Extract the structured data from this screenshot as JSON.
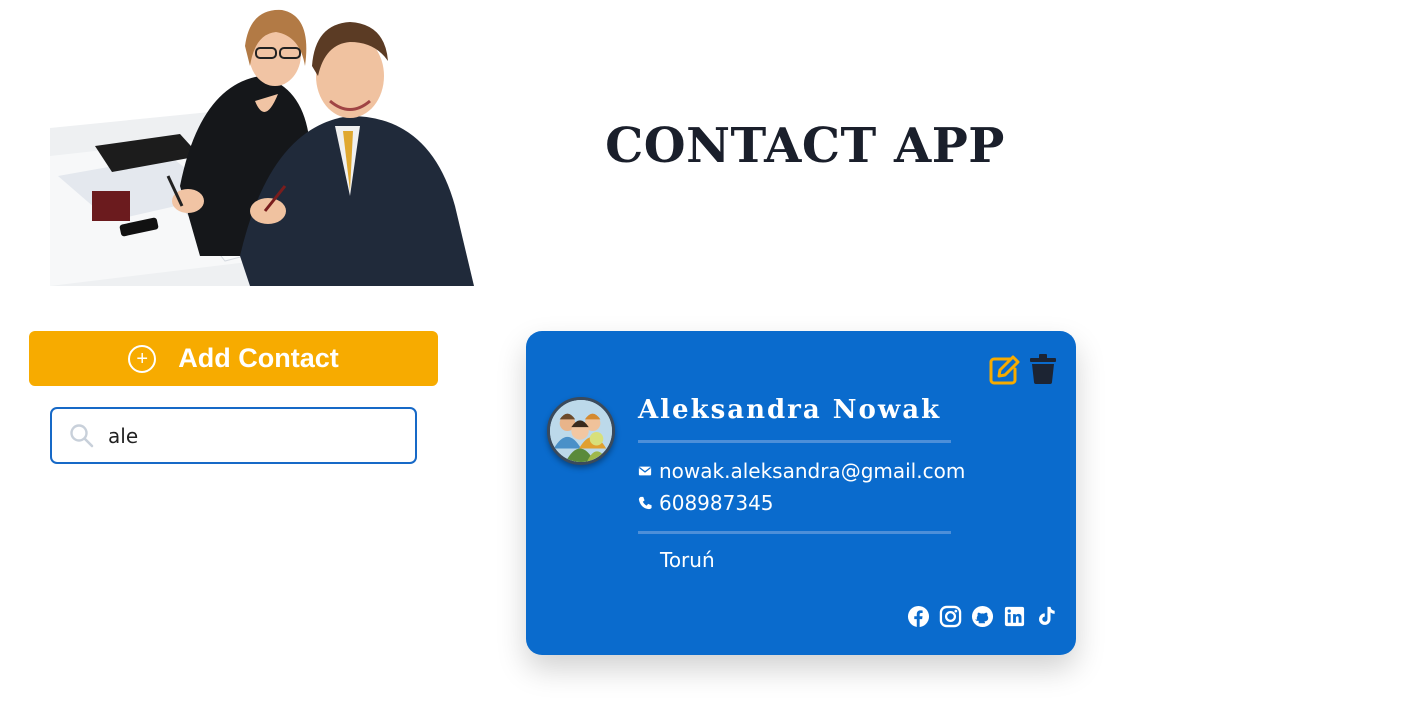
{
  "header": {
    "title": "CONTACT APP"
  },
  "hero": {
    "icon": "business-people-photo"
  },
  "actions": {
    "add_label": "Add Contact",
    "add_icon": "plus-circle-icon",
    "accent_color": "#f7ab00"
  },
  "search": {
    "value": "ale",
    "placeholder": "",
    "icon": "search-icon",
    "border_color": "#1769c7"
  },
  "contact": {
    "name": "Aleksandra Nowak",
    "email": "nowak.aleksandra@gmail.com",
    "phone": "608987345",
    "city": "Toruń",
    "avatar_icon": "group-avatar-icon",
    "card_color": "#0a6bcd",
    "actions": [
      "edit-icon",
      "trash-icon"
    ],
    "socials": [
      "facebook-icon",
      "instagram-icon",
      "github-icon",
      "linkedin-icon",
      "tiktok-icon"
    ]
  }
}
